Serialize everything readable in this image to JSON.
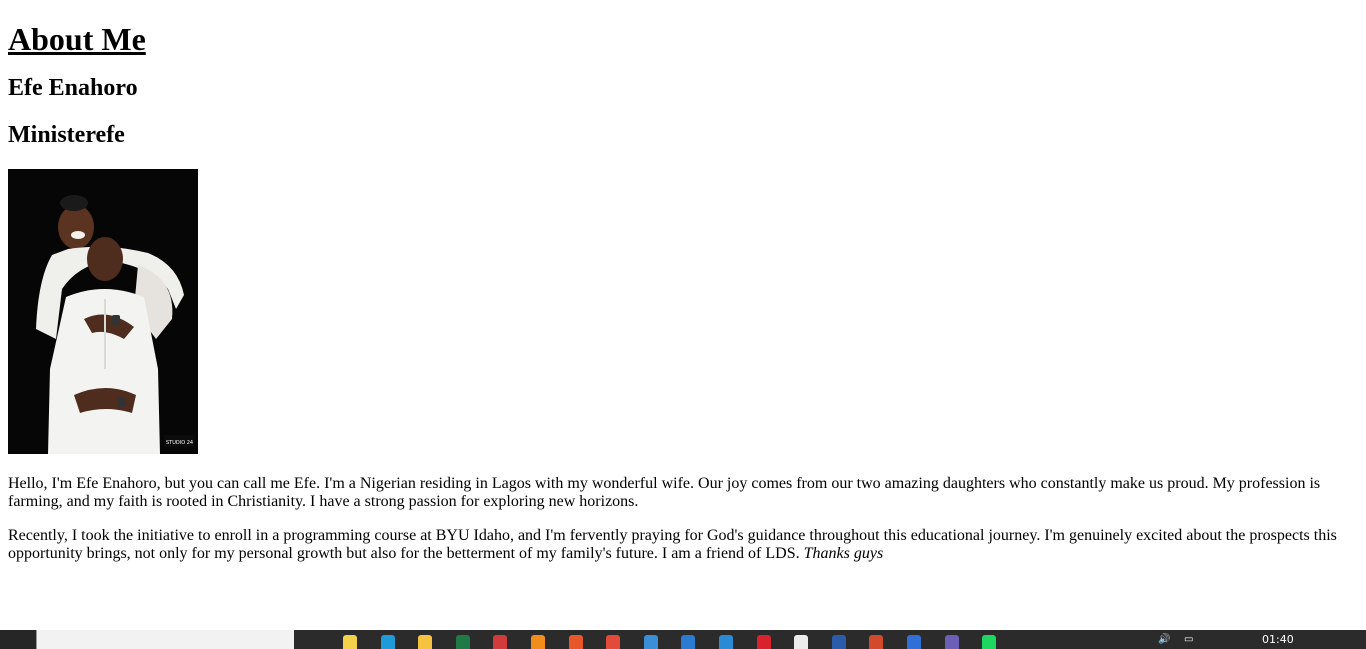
{
  "page": {
    "heading": "About Me",
    "name": "Efe Enahoro",
    "handle": "Ministerefe",
    "photo_alt": "Efe Enahoro and his wife",
    "photo_watermark": "STUDIO 24",
    "paragraph1": "Hello, I'm Efe Enahoro, but you can call me Efe. I'm a Nigerian residing in Lagos with my wonderful wife. Our joy comes from our two amazing daughters who constantly make us proud. My profession is farming, and my faith is rooted in Christianity. I have a strong passion for exploring new horizons.",
    "paragraph2": "Recently, I took the initiative to enroll in a programming course at BYU Idaho, and I'm fervently praying for God's guidance throughout this educational journey. I'm genuinely excited about the prospects this opportunity brings, not only for my personal growth but also for the betterment of my family's future. I am a friend of LDS.",
    "paragraph2_emphasis": "Thanks guys"
  },
  "taskbar": {
    "time": "01:40",
    "apps": [
      {
        "name": "notepad-icon",
        "color": "#f2d24b"
      },
      {
        "name": "edge-icon",
        "color": "#1e9bd8"
      },
      {
        "name": "file-explorer-icon",
        "color": "#f5c242"
      },
      {
        "name": "excel-icon",
        "color": "#1f7a45"
      },
      {
        "name": "audio-recorder-icon",
        "color": "#d23b3b"
      },
      {
        "name": "vlc-icon",
        "color": "#f28c1b"
      },
      {
        "name": "media-app-icon",
        "color": "#e8572a"
      },
      {
        "name": "chrome-icon",
        "color": "#e24a3a"
      },
      {
        "name": "app-icon",
        "color": "#3a8fd6"
      },
      {
        "name": "store-icon",
        "color": "#2b7bd1"
      },
      {
        "name": "vscode-icon",
        "color": "#2a8ad6"
      },
      {
        "name": "opera-icon",
        "color": "#d8232f"
      },
      {
        "name": "app2-icon",
        "color": "#ececec"
      },
      {
        "name": "word-icon",
        "color": "#2a5cab"
      },
      {
        "name": "powerpoint-icon",
        "color": "#d14a2b"
      },
      {
        "name": "maps-icon",
        "color": "#2f6fd6"
      },
      {
        "name": "app3-icon",
        "color": "#6b5fb8"
      },
      {
        "name": "spotify-icon",
        "color": "#1ed760"
      }
    ]
  }
}
